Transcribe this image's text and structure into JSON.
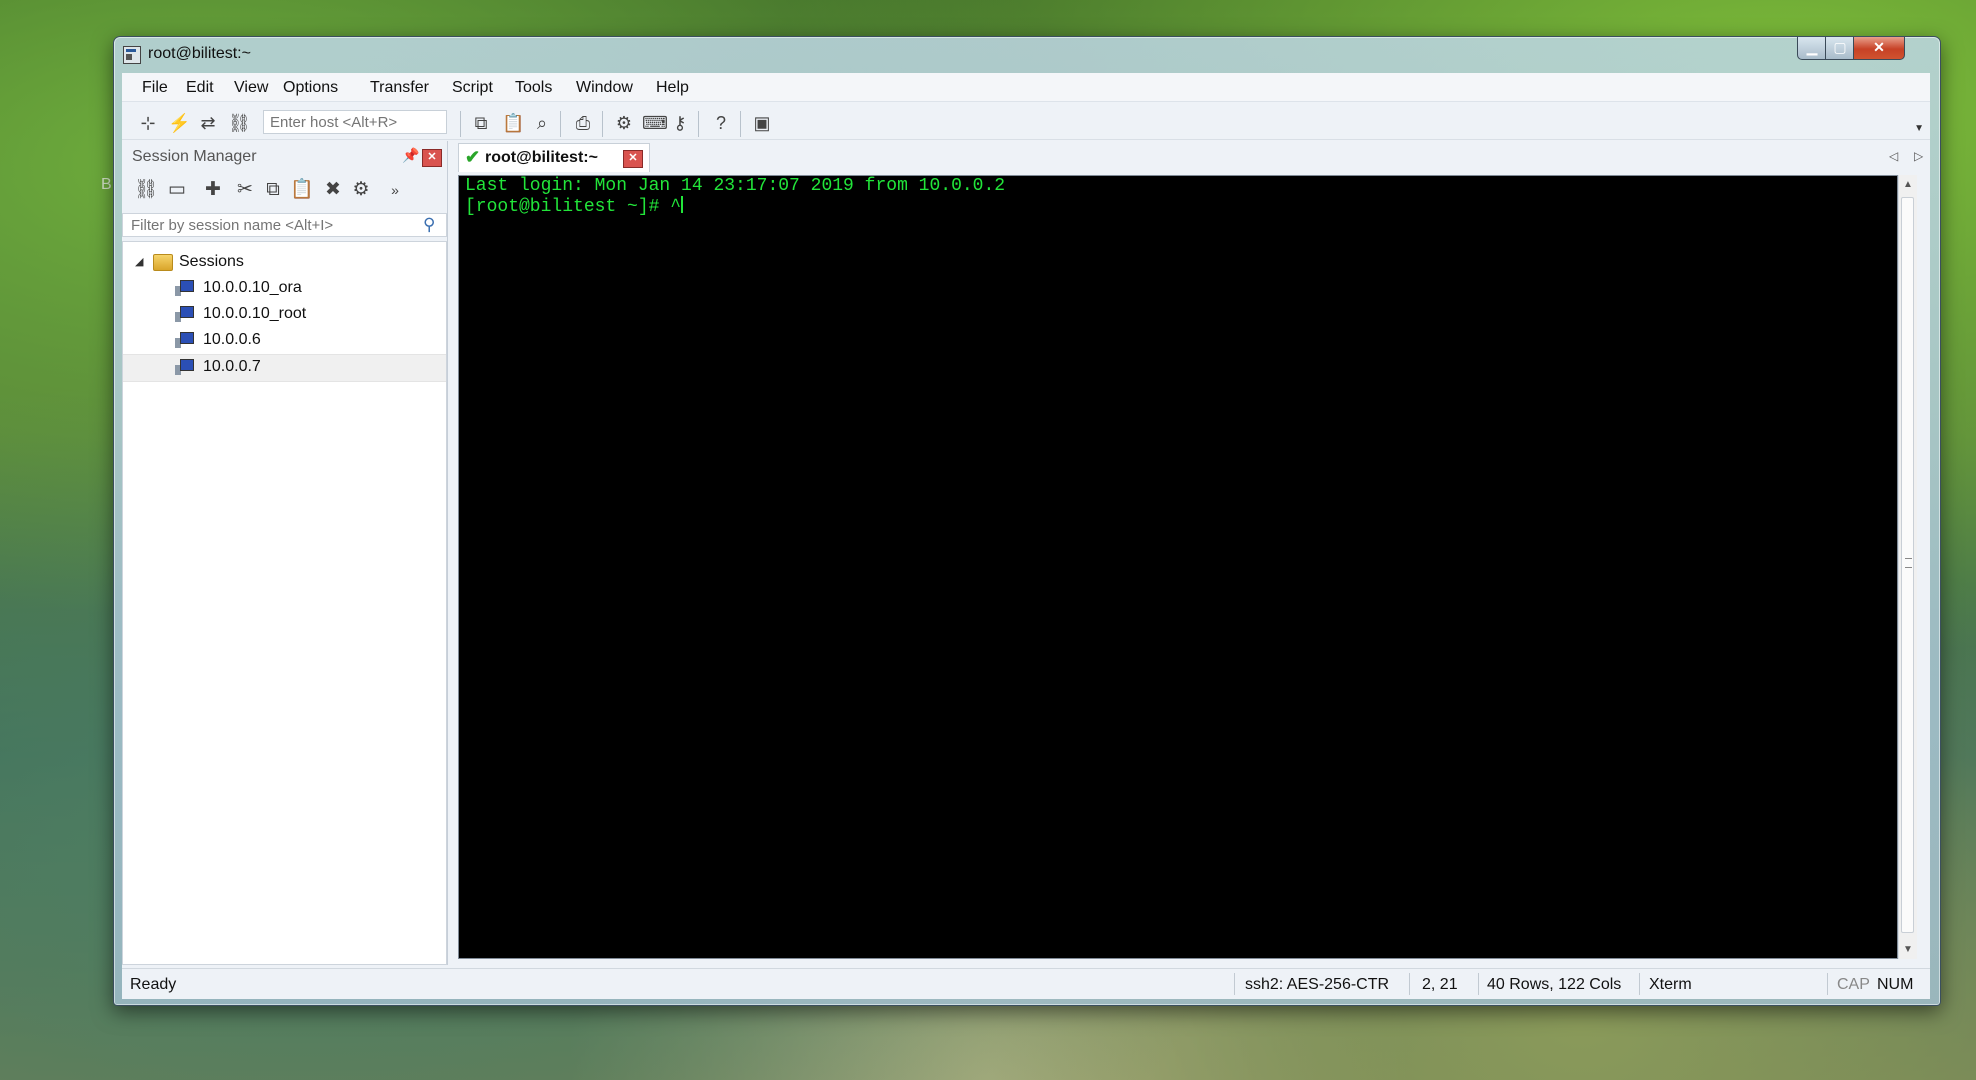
{
  "desktop": {
    "edge_letter": "B"
  },
  "window": {
    "title": "root@bilitest:~",
    "controls": {
      "minimize": "▁",
      "maximize": "▢",
      "close": "✕"
    }
  },
  "menu": [
    "File",
    "Edit",
    "View",
    "Options",
    "Transfer",
    "Script",
    "Tools",
    "Window",
    "Help"
  ],
  "toolbar": {
    "host_placeholder": "Enter host <Alt+R>",
    "icons": [
      "connect-icon",
      "quick-connect-icon",
      "reconnect-icon",
      "disconnect-icon",
      "copy-icon",
      "paste-icon",
      "find-icon",
      "print-icon",
      "settings-icon",
      "keymap-icon",
      "key-icon",
      "help-icon",
      "screenshot-icon"
    ]
  },
  "session_manager": {
    "title": "Session Manager",
    "filter_placeholder": "Filter by session name <Alt+I>",
    "folder": "Sessions",
    "sessions": [
      "10.0.0.10_ora",
      "10.0.0.10_root",
      "10.0.0.6",
      "10.0.0.7"
    ],
    "selected": "10.0.0.7"
  },
  "tabs": [
    {
      "label": "root@bilitest:~",
      "connected": true
    }
  ],
  "terminal": {
    "lines": [
      "Last login: Mon Jan 14 23:17:07 2019 from 10.0.0.2",
      "[root@bilitest ~]# ^"
    ],
    "text_color": "#22e53a"
  },
  "status": {
    "ready": "Ready",
    "cipher": "ssh2: AES-256-CTR",
    "cursor": "2,  21",
    "size": "40 Rows, 122 Cols",
    "term": "Xterm",
    "cap": "CAP",
    "num": "NUM"
  }
}
